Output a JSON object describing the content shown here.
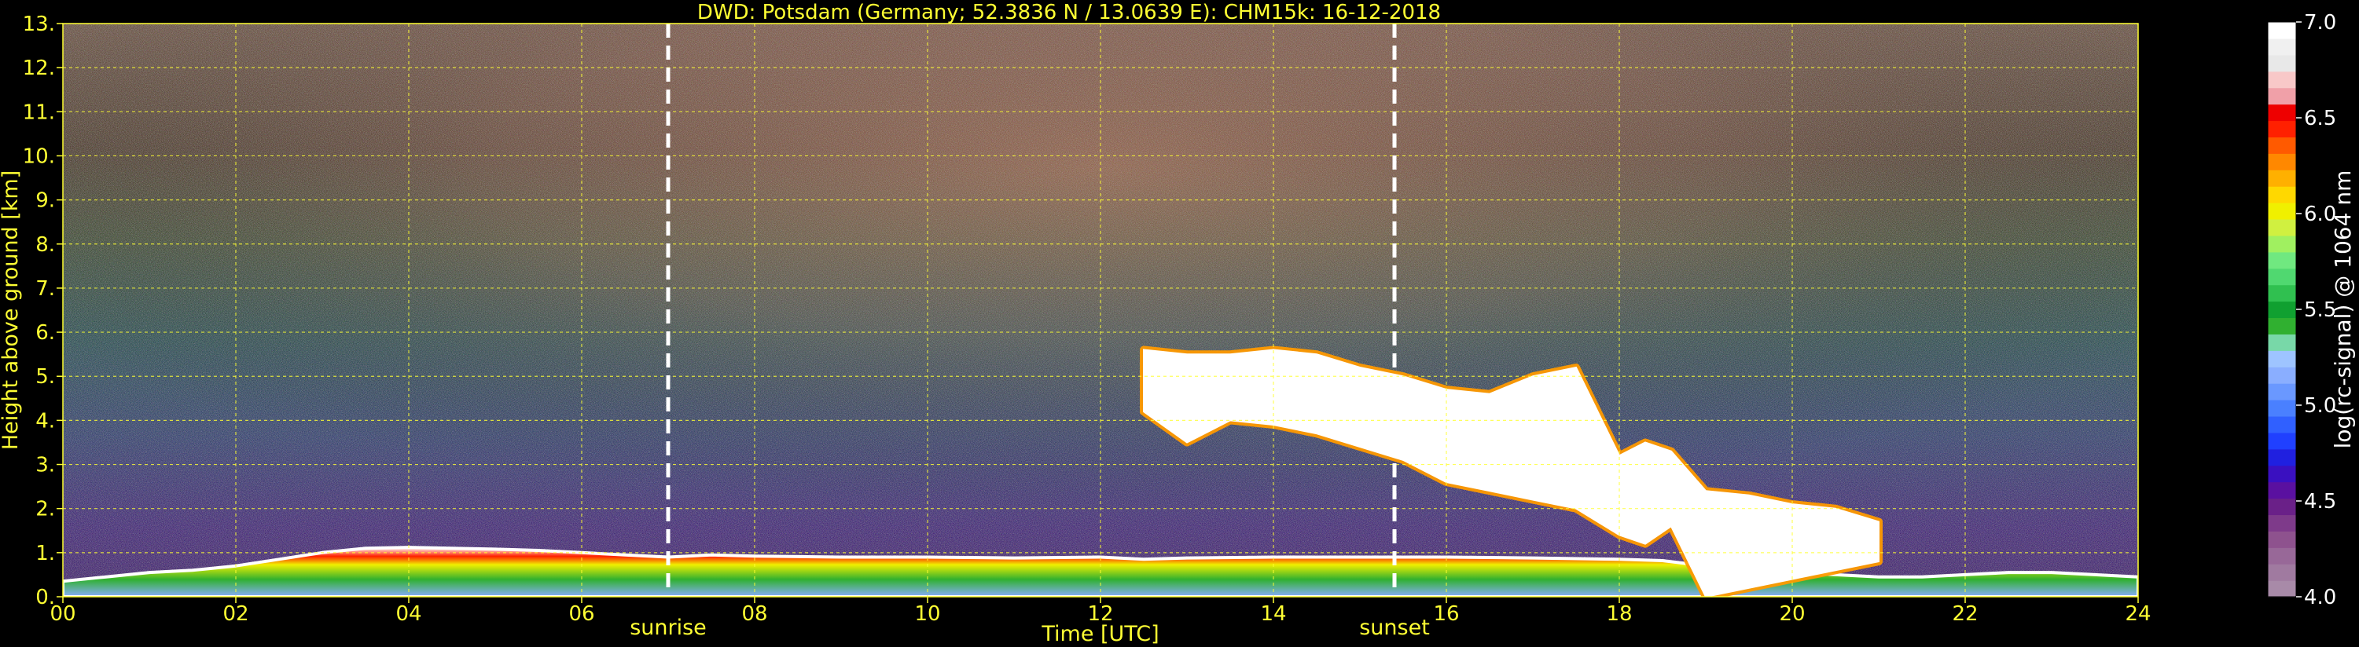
{
  "chart_data": {
    "type": "heatmap",
    "title": "DWD: Potsdam (Germany; 52.3836 N / 13.0639 E):    CHM15k: 16-12-2018",
    "xlabel": "Time [UTC]",
    "ylabel": "Height above ground [km]",
    "xlim": [
      0,
      24
    ],
    "ylim": [
      0,
      13
    ],
    "x_ticks": [
      0,
      2,
      4,
      6,
      8,
      10,
      12,
      14,
      16,
      18,
      20,
      22,
      24
    ],
    "x_tick_labels": [
      "00",
      "02",
      "04",
      "06",
      "08",
      "10",
      "12",
      "14",
      "16",
      "18",
      "20",
      "22",
      "24"
    ],
    "y_ticks": [
      0,
      1,
      2,
      3,
      4,
      5,
      6,
      7,
      8,
      9,
      10,
      11,
      12,
      13
    ],
    "y_tick_labels": [
      "0.",
      "1.",
      "2.",
      "3.",
      "4.",
      "5.",
      "6.",
      "7.",
      "8.",
      "9.",
      "10.",
      "11.",
      "12.",
      "13."
    ],
    "grid": true,
    "annotations": [
      {
        "label": "sunrise",
        "x": 7.0
      },
      {
        "label": "sunset",
        "x": 15.4
      }
    ],
    "colorbar": {
      "label": "log(rc-signal) @ 1064 nm",
      "range": [
        4.0,
        7.0
      ],
      "tick_values": [
        4.0,
        4.5,
        5.0,
        5.5,
        6.0,
        6.5,
        7.0
      ],
      "tick_labels": [
        "4.0",
        "4.5",
        "5.0",
        "5.5",
        "6.0",
        "6.5",
        "7.0"
      ],
      "colors": [
        "#a88aa8",
        "#a07aa0",
        "#986898",
        "#8e528e",
        "#7e3a8a",
        "#6a2088",
        "#5a10a0",
        "#3a10c0",
        "#2020e0",
        "#2040ff",
        "#3060ff",
        "#4a80ff",
        "#6a98ff",
        "#8aaeff",
        "#9ec4ff",
        "#78d8a8",
        "#30b030",
        "#10a030",
        "#30c050",
        "#50d870",
        "#70e880",
        "#a0f060",
        "#d0f040",
        "#f0f000",
        "#ffd800",
        "#ffb000",
        "#ff8800",
        "#ff5a00",
        "#ff2000",
        "#ee0000",
        "#f0a0a8",
        "#f8c8c8",
        "#e8e8e8",
        "#f0f0f0",
        "#ffffff"
      ]
    },
    "layers": [
      {
        "name": "boundary layer aerosol",
        "x": [
          0,
          0.5,
          1,
          1.5,
          2,
          2.5,
          3,
          3.5,
          4,
          4.5,
          5,
          5.5,
          6,
          6.5,
          7,
          7.5,
          8,
          9,
          10,
          11,
          12,
          12.5,
          13,
          14,
          15,
          16,
          17,
          18,
          18.5,
          19,
          19.5,
          20,
          20.5,
          21,
          21.5,
          22,
          22.5,
          23,
          23.5,
          24
        ],
        "top_km": [
          0.35,
          0.45,
          0.55,
          0.6,
          0.7,
          0.85,
          1.0,
          1.1,
          1.12,
          1.1,
          1.08,
          1.05,
          1.0,
          0.95,
          0.9,
          0.95,
          0.92,
          0.9,
          0.9,
          0.88,
          0.9,
          0.85,
          0.88,
          0.9,
          0.9,
          0.9,
          0.88,
          0.85,
          0.82,
          0.7,
          0.6,
          0.55,
          0.5,
          0.45,
          0.45,
          0.5,
          0.55,
          0.55,
          0.5,
          0.45
        ]
      },
      {
        "name": "cloud",
        "x": [
          12.5,
          13.0,
          13.5,
          14.0,
          14.5,
          15.0,
          15.5,
          16.0,
          16.5,
          17.0,
          17.5,
          18.0,
          18.3,
          18.6,
          19.0,
          19.5,
          20.0,
          20.5,
          21.0
        ],
        "top_km": [
          5.6,
          5.5,
          5.5,
          5.6,
          5.5,
          5.2,
          5.0,
          4.7,
          4.6,
          5.0,
          5.2,
          3.2,
          3.5,
          3.3,
          2.4,
          2.3,
          2.1,
          2.0,
          1.7
        ],
        "base_km": [
          4.2,
          3.5,
          4.0,
          3.9,
          3.7,
          3.4,
          3.1,
          2.6,
          2.4,
          2.2,
          2.0,
          1.4,
          1.2,
          1.6,
          0.0,
          0.2,
          0.4,
          0.6,
          0.8
        ]
      }
    ]
  }
}
